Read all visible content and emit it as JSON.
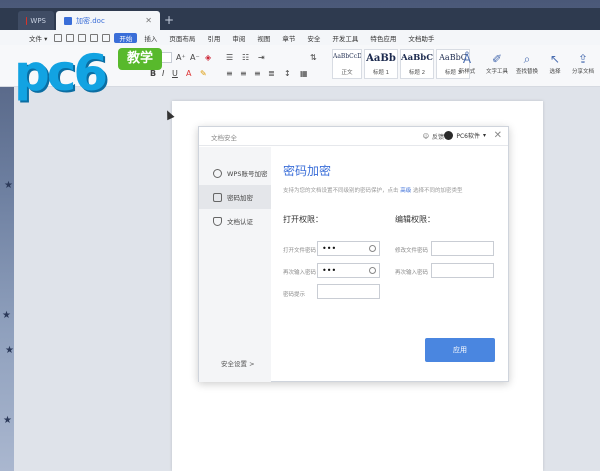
{
  "titlebar": {
    "tabs": [
      {
        "label": "WPS"
      },
      {
        "label": "加密.doc"
      }
    ]
  },
  "menubar": {
    "file_label": "文件",
    "items": [
      "开始",
      "插入",
      "页面布局",
      "引用",
      "审阅",
      "视图",
      "章节",
      "安全",
      "开发工具",
      "特色应用",
      "文档助手"
    ],
    "active": "开始"
  },
  "ribbon": {
    "styles": [
      {
        "sample": "AaBbCcDd",
        "name": "正文"
      },
      {
        "sample": "AaBb",
        "name": "标题 1"
      },
      {
        "sample": "AaBbC",
        "name": "标题 2"
      },
      {
        "sample": "AaBbC",
        "name": "标题 3"
      }
    ],
    "tools": [
      "新样式",
      "文字工具",
      "查找替换",
      "选择",
      "分享文档"
    ]
  },
  "logo": {
    "text": "pc6",
    "badge": "教学"
  },
  "dialog": {
    "title": "文档安全",
    "feedback": "反馈",
    "user": "PC6软件",
    "sidebar": {
      "items": [
        {
          "label": "WPS账号加密",
          "icon": "user-icon"
        },
        {
          "label": "密码加密",
          "icon": "lock-icon"
        },
        {
          "label": "文档认证",
          "icon": "shield-icon"
        }
      ],
      "footer": "安全设置 >"
    },
    "main": {
      "title": "密码加密",
      "desc_before": "支持为您的文档设置不同级别的密码保护，点击",
      "desc_link": "高级",
      "desc_after": "选择不同的加密类型",
      "open_perm": {
        "heading": "打开权限：",
        "password_label": "打开文件密码",
        "password_value": "•••",
        "confirm_label": "再次输入密码",
        "confirm_value": "•••",
        "hint_label": "密码提示",
        "hint_value": ""
      },
      "edit_perm": {
        "heading": "编辑权限：",
        "password_label": "修改文件密码",
        "password_value": "",
        "confirm_label": "再次输入密码",
        "confirm_value": ""
      },
      "apply_label": "应用"
    }
  }
}
